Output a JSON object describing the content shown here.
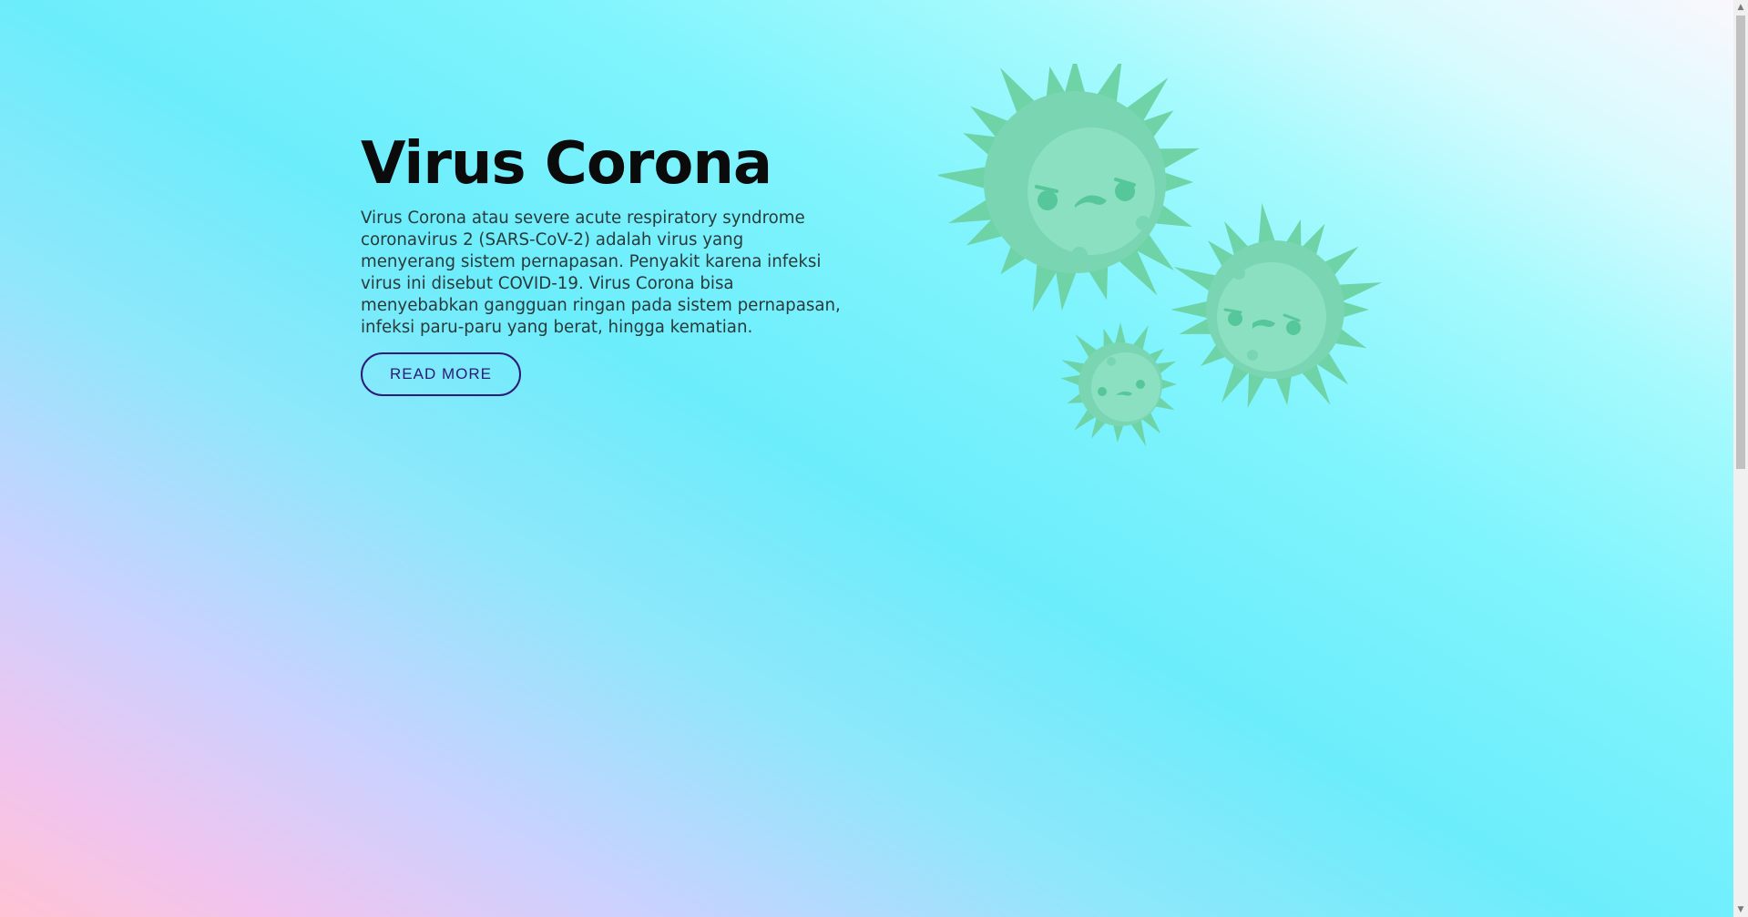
{
  "hero": {
    "title": "Virus Corona",
    "description": "Virus Corona atau severe acute respiratory syndrome coronavirus 2 (SARS-CoV-2) adalah virus yang menyerang sistem pernapasan. Penyakit karena infeksi virus ini disebut COVID-19. Virus Corona bisa menyebabkan gangguan ringan pada sistem pernapasan, infeksi paru-paru yang berat, hingga kematian.",
    "button_label": "READ MORE"
  },
  "illustration": {
    "icon": "virus-illustration",
    "colors": {
      "spike": "#6fd3a8",
      "body": "#86dfbd",
      "face": "#55c79a"
    }
  },
  "scrollbar": {
    "up_icon": "▲",
    "down_icon": "▼"
  },
  "colors": {
    "title": "#0b0b0b",
    "text": "#2a3a3a",
    "button_border": "#2c1a78"
  }
}
